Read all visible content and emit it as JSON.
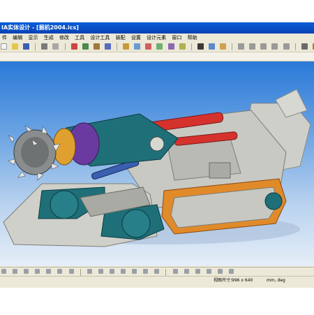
{
  "window": {
    "title": "IA实体设计 - [掘机2004.ics]"
  },
  "menu": {
    "items": [
      "件",
      "编辑",
      "显示",
      "生成",
      "修改",
      "工具",
      "设计工具",
      "装配",
      "设置",
      "设计元素",
      "窗口",
      "帮助"
    ]
  },
  "status": {
    "label": "视图尺寸：",
    "value": "996 x 640",
    "unit": "mm, deg"
  },
  "colors": {
    "title_bar": "#0842b4",
    "viewport_top": "#2a79d8",
    "viewport_bottom": "#e6eef8",
    "machine_body": "#c8c9c2",
    "cutter_arm": "#1f6f78",
    "cylinder": "#d5322e",
    "crawler_track": "#e08a2a",
    "motor": "#6b3aa0"
  }
}
